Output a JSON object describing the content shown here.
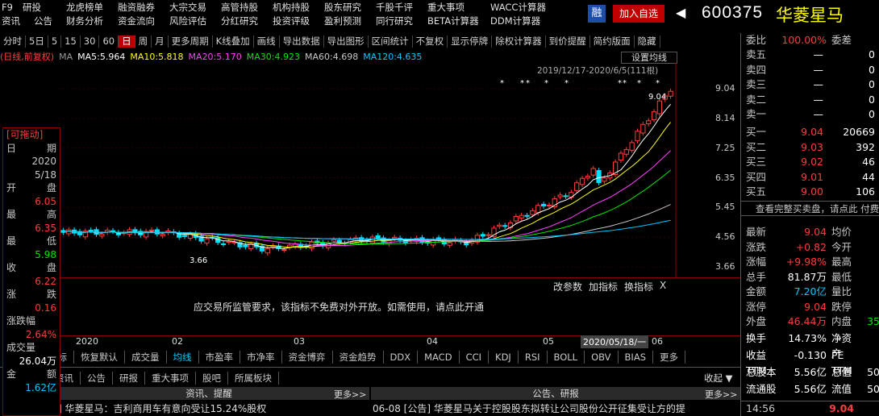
{
  "menu": {
    "row1": [
      [
        "F9",
        0
      ],
      [
        "研投",
        26
      ],
      [
        "龙虎榜单",
        80
      ],
      [
        "融资融券",
        144
      ],
      [
        "大宗交易",
        208
      ],
      [
        "高管持股",
        272
      ],
      [
        "机构持股",
        336
      ],
      [
        "股东研究",
        400
      ],
      [
        "千股千评",
        464
      ],
      [
        "重大事项",
        528
      ],
      [
        "WACC计算器",
        606
      ]
    ],
    "row2": [
      [
        "资讯",
        0
      ],
      [
        "公告",
        40
      ],
      [
        "财务分析",
        80
      ],
      [
        "资金流向",
        144
      ],
      [
        "风险评估",
        208
      ],
      [
        "分红研究",
        272
      ],
      [
        "投资评级",
        336
      ],
      [
        "盈利预测",
        400
      ],
      [
        "同行研究",
        464
      ],
      [
        "BETA计算器",
        528
      ],
      [
        "DDM计算器",
        606
      ]
    ]
  },
  "header": {
    "rong": "融",
    "add_watch": "加入自选",
    "code": "600375",
    "name": "华菱星马"
  },
  "toolbar": {
    "items": [
      "分时",
      "5日",
      "5",
      "15",
      "30",
      "60",
      "日",
      "周",
      "月",
      "更多周期",
      "K线叠加",
      "画线",
      "导出数据",
      "导出图形",
      "区间统计",
      "不复权",
      "显示停牌",
      "除权计算器",
      "到价提醒",
      "简约版面",
      "隐藏"
    ],
    "active": "日"
  },
  "ma_bar": {
    "period": "(日线,前复权)",
    "ma_label": "MA",
    "ma5": "MA5:5.964",
    "ma10": "MA10:5.818",
    "ma20": "MA20:5.170",
    "ma30": "MA30:4.923",
    "ma60": "MA60:4.698",
    "ma120": "MA120:4.635",
    "setting": "设置均线"
  },
  "chart": {
    "range_label": "2019/12/17-2020/6/5(111根)",
    "high_label": "9.04",
    "low_label": "3.66",
    "y_ticks": [
      "9.04",
      "8.14",
      "7.25",
      "6.35",
      "5.45",
      "4.56",
      "3.66"
    ],
    "x_labels": [
      "2020",
      "02",
      "03",
      "04",
      "05",
      "06"
    ],
    "crosshair_date": "2020/05/18/一",
    "indicator_msg": "应交易所监管要求，该指标不免费对外开放。如需使用，请点此开通",
    "ind_btns": [
      "改参数",
      "加指标",
      "换指标",
      "X"
    ]
  },
  "chart_data": {
    "type": "candlestick",
    "title": "",
    "xlabel": "",
    "ylabel": "",
    "ylim": [
      3.66,
      9.04
    ],
    "x": [
      "2019-12",
      "2020-01",
      "2020-02",
      "2020-03",
      "2020-04",
      "2020-05",
      "2020-06"
    ],
    "close_trend": [
      4.7,
      4.7,
      4.2,
      4.5,
      4.4,
      5.9,
      9.04
    ],
    "high": 9.04,
    "low": 3.66
  },
  "info_panel": {
    "drag": "[可拖动]",
    "date_label": [
      "日",
      "期"
    ],
    "year": "2020",
    "date": "5/18",
    "open_label": [
      "开",
      "盘"
    ],
    "open": "6.05",
    "high_label": [
      "最",
      "高"
    ],
    "high": "6.35",
    "low_label": [
      "最",
      "低"
    ],
    "low": "5.98",
    "close_label": [
      "收",
      "盘"
    ],
    "close": "6.22",
    "chg_label": [
      "涨",
      "跌"
    ],
    "chg": "0.16",
    "pct_label": "涨跌幅",
    "pct": "2.64%",
    "vol_label": "成交量",
    "vol": "26.04万",
    "amt_label": [
      "金",
      "额"
    ],
    "amt": "1.62亿"
  },
  "indicator_tabs": [
    "指标",
    "恢复默认",
    "成交量",
    "均线",
    "市盈率",
    "市净率",
    "资金博弈",
    "资金趋势",
    "DDX",
    "MACD",
    "CCI",
    "KDJ",
    "RSI",
    "BOLL",
    "OBV",
    "BIAS",
    "更多"
  ],
  "news_tabs": [
    "资讯",
    "公告",
    "研报",
    "重大事项",
    "股吧",
    "所属板块"
  ],
  "collapse": "收起",
  "news": {
    "left_title": "资讯、提醒",
    "more": "更多>>",
    "right_title": "公告、研报",
    "left_item": "讯] 华菱星马：吉利商用车有意向受让15.24%股权",
    "right_item": "06-08 [公告] 华菱星马关于控股股东拟转让公司股份公开征集受让方的提"
  },
  "order_book": {
    "webi_label": "委比",
    "webi": "100.00%",
    "wecha": "委差",
    "sells": [
      [
        "卖五",
        "—",
        "0"
      ],
      [
        "卖四",
        "—",
        "0"
      ],
      [
        "卖三",
        "—",
        "0"
      ],
      [
        "卖二",
        "—",
        "0"
      ],
      [
        "卖一",
        "—",
        "0"
      ]
    ],
    "buys": [
      [
        "买一",
        "9.04",
        "20669"
      ],
      [
        "买二",
        "9.03",
        "392"
      ],
      [
        "买三",
        "9.02",
        "46"
      ],
      [
        "买四",
        "9.01",
        "44"
      ],
      [
        "买五",
        "9.00",
        "106"
      ]
    ],
    "view_full": "查看完整买卖盘，请点此 付费"
  },
  "quote": {
    "rows": [
      [
        "最新",
        "9.04",
        "均价",
        ""
      ],
      [
        "涨跌",
        "+0.82",
        "今开",
        ""
      ],
      [
        "涨幅",
        "+9.98%",
        "最高",
        ""
      ],
      [
        "总手",
        "81.87万",
        "最低",
        ""
      ],
      [
        "金额",
        "7.20亿",
        "量比",
        ""
      ],
      [
        "涨停",
        "9.04",
        "跌停",
        ""
      ],
      [
        "外盘",
        "46.44万",
        "内盘",
        "35"
      ]
    ]
  },
  "stats": {
    "rows": [
      [
        "换手",
        "14.73%",
        "净资产",
        ""
      ],
      [
        "收益TTM",
        "-0.130",
        "PE TTM",
        ""
      ],
      [
        "总股本",
        "5.56亿",
        "总值",
        "50"
      ],
      [
        "流通股",
        "5.56亿",
        "流值",
        "50"
      ]
    ]
  },
  "tick": {
    "time": "14:56",
    "price": "9.04"
  }
}
